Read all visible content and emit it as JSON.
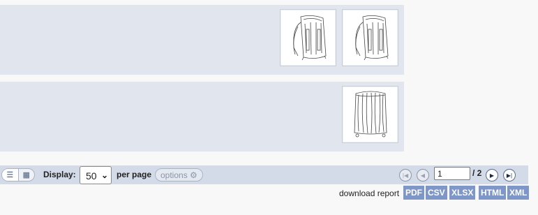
{
  "rows": [
    {
      "thumbs": [
        "backpack-drawing-icon",
        "backpack-drawing-icon"
      ]
    },
    {
      "thumbs": [
        "suitcase-drawing-icon"
      ]
    }
  ],
  "toolbar": {
    "view_list_icon": "list-view-icon",
    "view_grid_icon": "grid-view-icon",
    "display_label": "Display:",
    "per_page_value": "50",
    "per_page_label": "per page",
    "options_label": "options ⚙",
    "page_value": "1",
    "page_total": "/ 2"
  },
  "download": {
    "label": "download report",
    "formats": [
      "PDF",
      "CSV",
      "XLSX",
      "HTML",
      "XML"
    ]
  },
  "colors": {
    "row_bg": "#e0e5ee",
    "bar_bg": "#d4dbe8",
    "format_bg": "#7e97c8"
  }
}
